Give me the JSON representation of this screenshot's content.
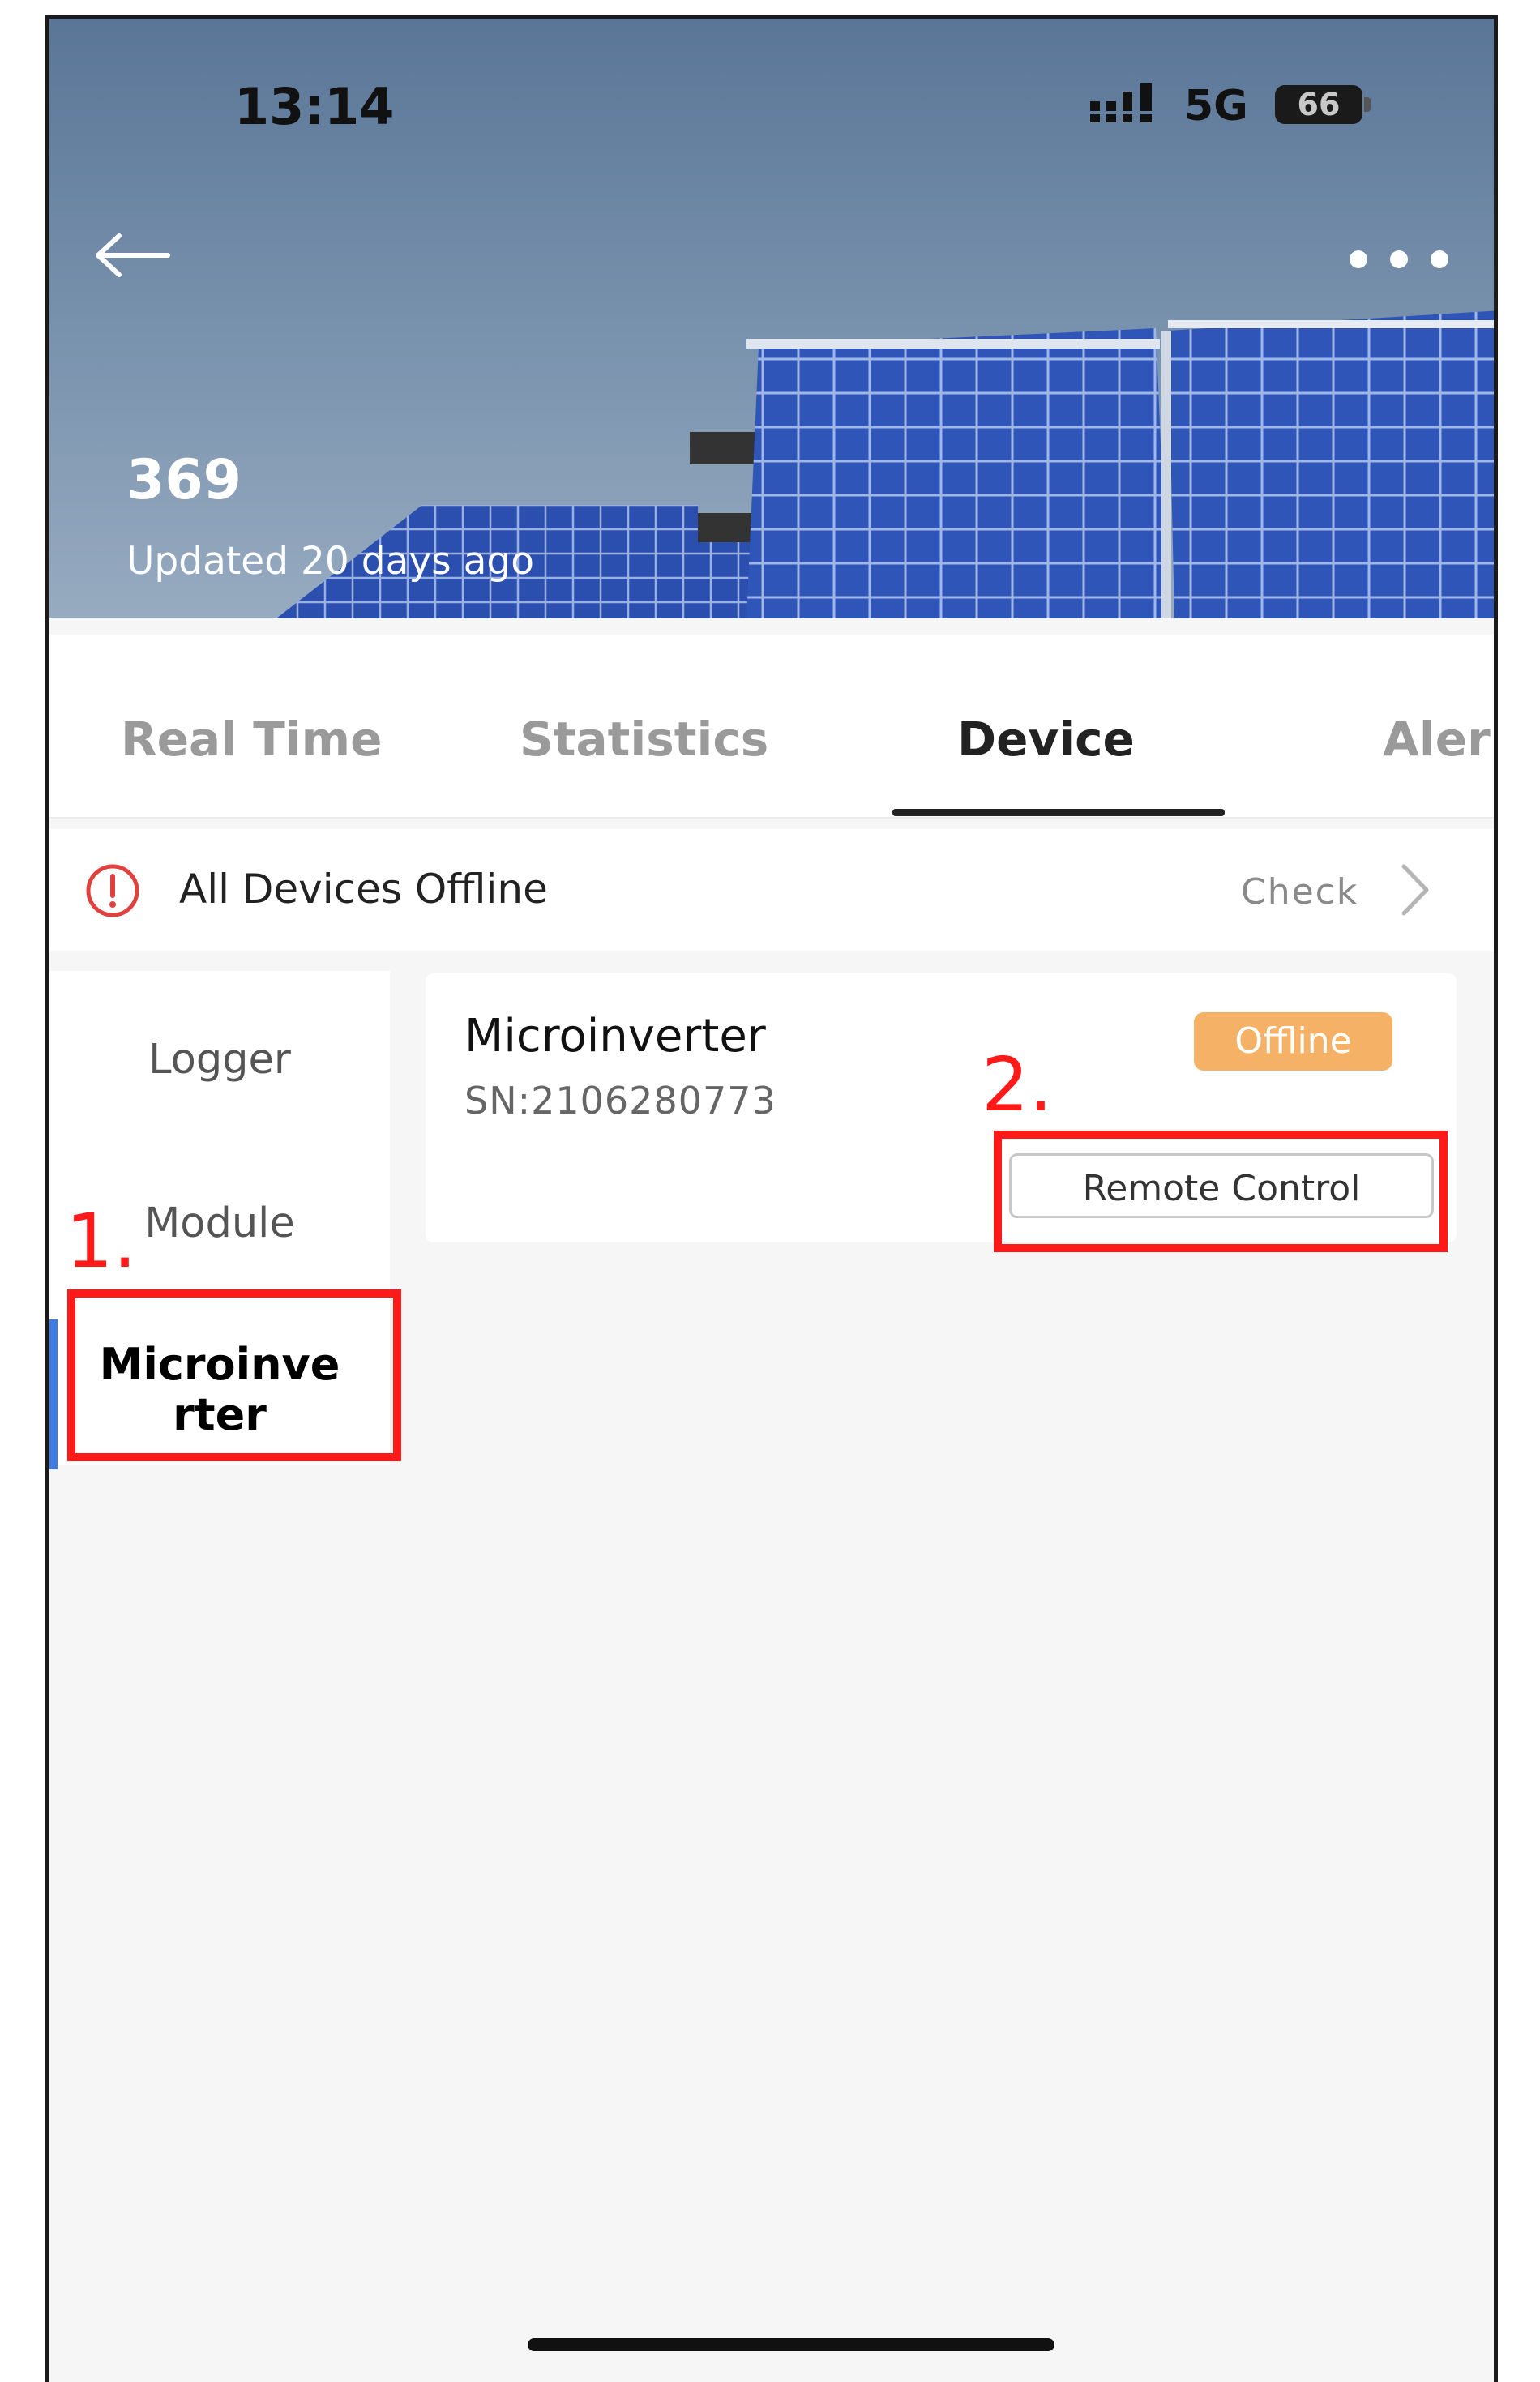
{
  "status_bar": {
    "time": "13:14",
    "network": "5G",
    "battery": "66",
    "battery_level_percent": 66
  },
  "header": {
    "plant_value": "369",
    "updated": "Updated 20 days ago",
    "back_icon": "arrow-left-icon",
    "more_icon": "more-dots-icon"
  },
  "tabs": [
    {
      "label": "Real Time"
    },
    {
      "label": "Statistics"
    },
    {
      "label": "Device",
      "active": true
    },
    {
      "label": "Aler"
    }
  ],
  "alert": {
    "text": "All Devices Offline",
    "action": "Check",
    "icon": "warning-circle-icon",
    "color": "#e0413f"
  },
  "device_nav": {
    "items": [
      {
        "label": "Logger"
      },
      {
        "label": "Module"
      },
      {
        "label": "Microinverter",
        "line1": "Microinve",
        "line2": "rter",
        "active": true
      }
    ]
  },
  "device_card": {
    "name": "Microinverter",
    "sn": "SN:2106280773",
    "status": "Offline",
    "status_color": "#f5b266",
    "remote_control_label": "Remote Control"
  },
  "annotations": {
    "step1": "1.",
    "step2": "2.",
    "color": "#ff1a1a"
  }
}
